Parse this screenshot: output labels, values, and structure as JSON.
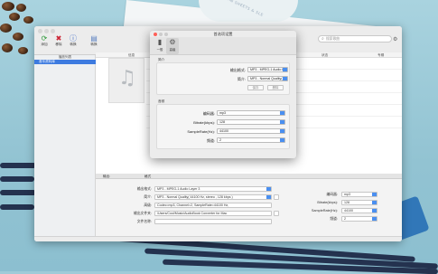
{
  "window": {
    "toolbar": [
      {
        "label": "添加",
        "icon": "refresh-add-icon"
      },
      {
        "label": "移除",
        "icon": "tools-remove-icon"
      },
      {
        "label": "转换",
        "icon": "info-convert-icon"
      },
      {
        "label": "转换",
        "icon": "books-icon"
      }
    ],
    "search_placeholder": "搜索歌曲",
    "sidebar": {
      "header": "播放列表",
      "items": [
        "音乐资料库"
      ]
    },
    "table_columns": [
      "信息",
      "状态",
      "专辑"
    ],
    "bottom_tabs": [
      "输出:",
      "格式"
    ],
    "output": {
      "format_label": "输出格式:",
      "format_value": "MP3 - MPEG-1 Audio Layer 3",
      "profile_label": "简介:",
      "profile_value": "MP3 - Normal Quality( 44100 Hz, stereo , 128 kbps )",
      "codec_label": "高级:",
      "codec_value": "Codec=mp3, Channel=2, SampleRate=44100 Hz,",
      "folder_label": "输出文件夹:",
      "folder_value": "/Users/Cool/Music/AudioBook Converter for Mac",
      "filename_label": "文件名称:",
      "filename_value": ""
    },
    "right_params": [
      {
        "label": "编码器:",
        "value": "mp3"
      },
      {
        "label": "Bitrate(kbps):",
        "value": "128"
      },
      {
        "label": "SampleRate(Hz):",
        "value": "44100"
      },
      {
        "label": "频道:",
        "value": "2"
      }
    ]
  },
  "dialog": {
    "title": "首选项设置",
    "tabs": [
      {
        "label": "一般",
        "icon": "phone-icon"
      },
      {
        "label": "高级",
        "icon": "gear-icon"
      }
    ],
    "profile_group": {
      "title": "简介",
      "format_label": "输出格式:",
      "format_value": "MP3 - MPEG-1 Audio Layer 3",
      "profile_label": "简介:",
      "profile_value": "MP3 - Normal Quality( 44100 Hz",
      "save_button": "保存",
      "delete_button": "删除"
    },
    "audio_group": {
      "title": "音频",
      "params": [
        {
          "label": "编码器:",
          "value": "mp3"
        },
        {
          "label": "Bitrate(kbps):",
          "value": "128"
        },
        {
          "label": "SampleRate(Hz):",
          "value": "44100"
        },
        {
          "label": "频道:",
          "value": "2"
        }
      ]
    }
  },
  "background": {
    "paper_text": "PLAN SHEETS & SLE"
  },
  "colors": {
    "accent": "#3d7be0",
    "select_arrow": "#4a8ff0",
    "desk": "#9fcbd8"
  }
}
